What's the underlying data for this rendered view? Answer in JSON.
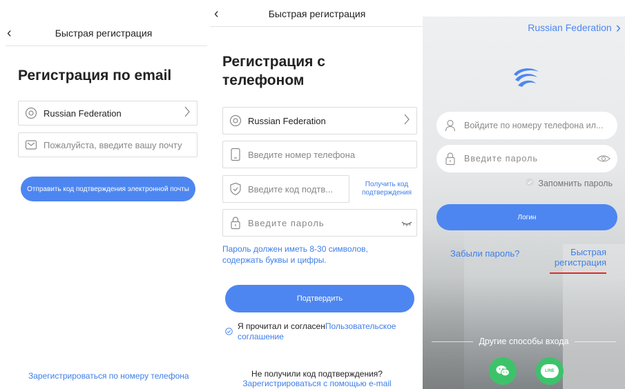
{
  "email_screen": {
    "header_title": "Быстрая регистрация",
    "back_glyph": "‹",
    "title": "Регистрация по email",
    "country": "Russian Federation",
    "email_placeholder": "Пожалуйста, введите вашу почту",
    "send_code_button": "Отправить код подтверждения электронной почты",
    "register_by_phone_link": "Зарегистрироваться по номеру телефона"
  },
  "phone_screen": {
    "header_title": "Быстрая регистрация",
    "back_glyph": "‹",
    "title_line1": "Регистрация с",
    "title_line2": "телефоном",
    "country": "Russian Federation",
    "phone_placeholder": "Введите номер телефона",
    "code_placeholder": "Введите код подтв...",
    "get_code_line1": "Получить код",
    "get_code_line2": "подтверждения",
    "password_placeholder": "Введите пароль",
    "password_hint_line1": "Пароль должен иметь 8-30 символов,",
    "password_hint_line2": "содержать буквы и цифры.",
    "confirm_button": "Подтвердить",
    "agree_text": "Я прочитал и согласен",
    "agreement_link_part1": "Пользовательское",
    "agreement_link_part2": "соглашение",
    "no_code_text": "Не получили код подтверждения?",
    "register_email_link": "Зарегистрироваться с помощью e-mail"
  },
  "login_screen": {
    "region": "Russian Federation",
    "region_chevron": "›",
    "username_placeholder": "Войдите по номеру телефона ил...",
    "password_placeholder": "Введите пароль",
    "remember_label": "Запомнить пароль",
    "login_button": "Логин",
    "forgot_password": "Забыли пароль?",
    "quick_register_line1": "Быстрая",
    "quick_register_line2": "регистрация",
    "other_methods": "Другие способы входа",
    "line_badge": "LINE"
  },
  "colors": {
    "accent": "#4d86f0",
    "link": "#3d7ee8",
    "wechat": "#3cc36a",
    "line": "#3cc36a",
    "underline_red": "#e02a2a"
  }
}
